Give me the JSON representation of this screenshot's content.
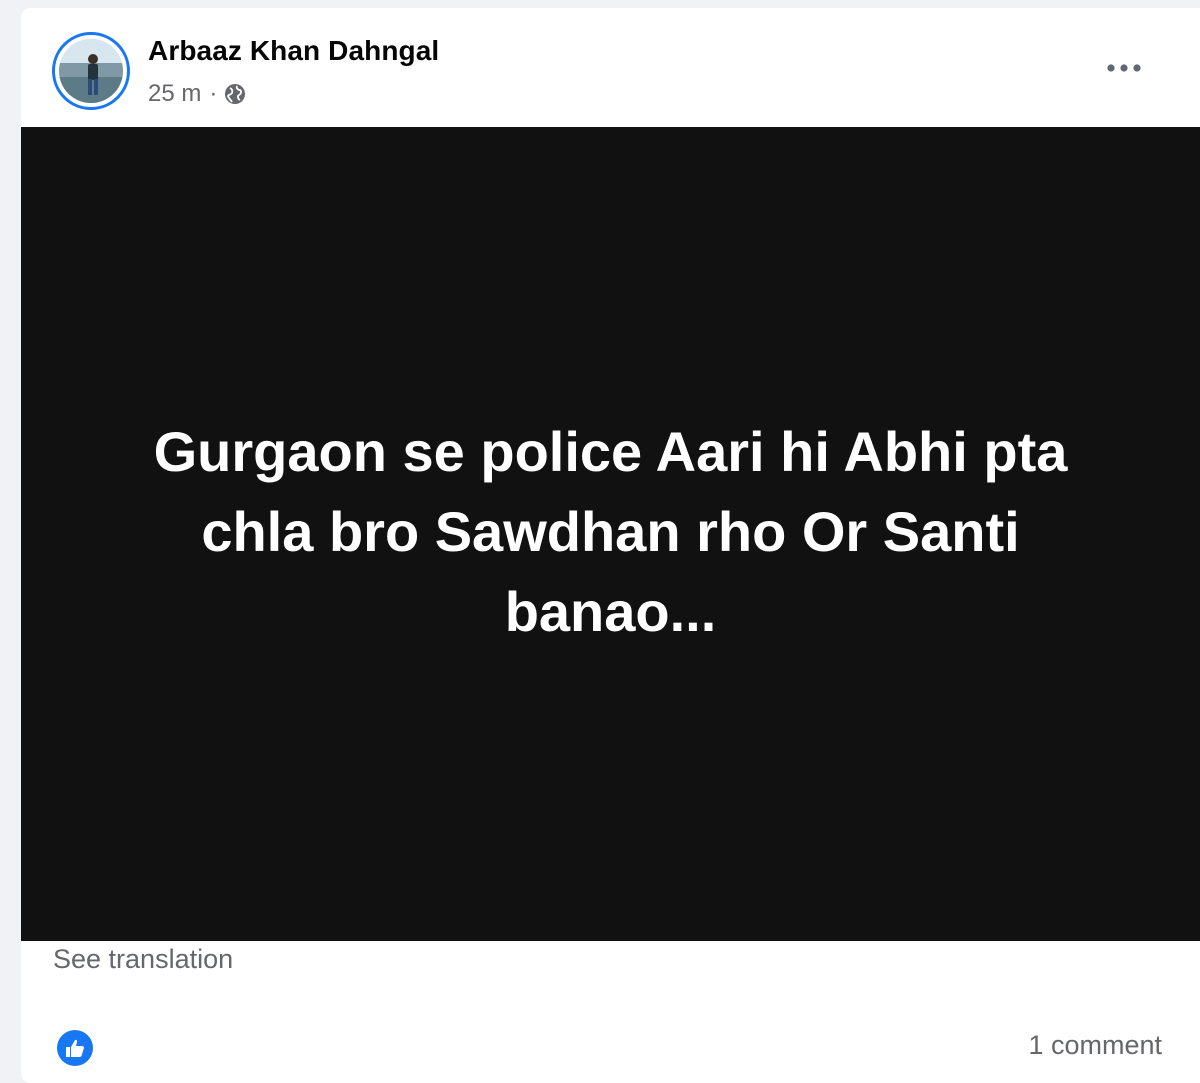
{
  "post": {
    "author": "Arbaaz Khan Dahngal",
    "time": "25 m",
    "separator": "·",
    "privacy_icon": "globe-icon",
    "more_icon": "more-options-icon",
    "image_text": "Gurgaon se police Aari hi Abhi pta chla bro Sawdhan rho Or Santi banao...",
    "see_translation": "See translation",
    "reaction_icon": "like-icon",
    "comment_count": "1 comment"
  },
  "colors": {
    "accent": "#1877f2",
    "secondary_text": "#65676b",
    "image_background": "#111111"
  }
}
